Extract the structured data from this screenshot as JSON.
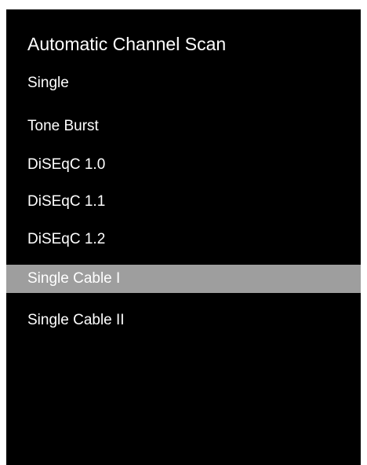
{
  "menu": {
    "title": "Automatic Channel Scan",
    "items": [
      {
        "label": "Single"
      },
      {
        "label": "Tone Burst"
      },
      {
        "label": "DiSEqC 1.0"
      },
      {
        "label": "DiSEqC 1.1"
      },
      {
        "label": "DiSEqC 1.2"
      },
      {
        "label": "Single Cable I",
        "selected": true
      },
      {
        "label": "Single Cable II"
      }
    ]
  },
  "colors": {
    "background": "#000000",
    "highlight": "#9e9e9e",
    "text": "#ffffff"
  }
}
